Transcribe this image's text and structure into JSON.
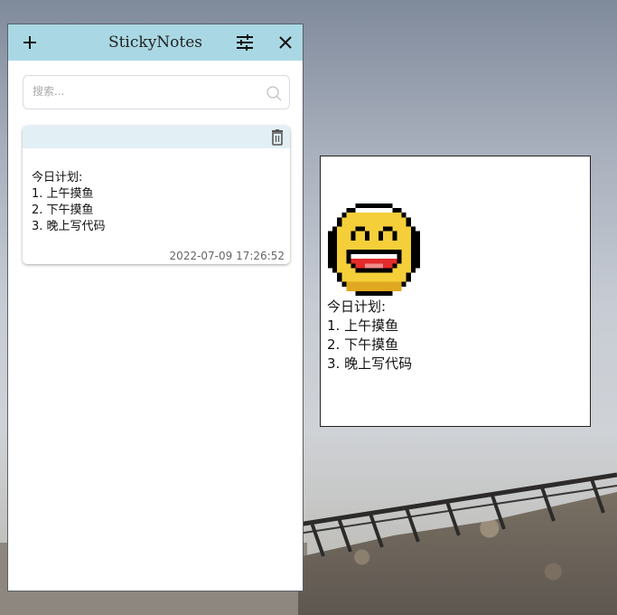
{
  "app": {
    "title": "StickyNotes",
    "add_icon": "plus-icon",
    "settings_icon": "sliders-icon",
    "close_icon": "close-icon",
    "titlebar_color": "#a9d8e4"
  },
  "search": {
    "placeholder": "搜索...",
    "value": "",
    "icon": "search-icon"
  },
  "notes": [
    {
      "lines": [
        "今日计划:",
        "1. 上午摸鱼",
        "2. 下午摸鱼",
        "3. 晚上写代码"
      ],
      "timestamp": "2022-07-09 17:26:52",
      "delete_icon": "trash-icon"
    }
  ],
  "open_note": {
    "image": "pixel-smiley-face",
    "lines": [
      "今日计划:",
      "1. 上午摸鱼",
      "2. 下午摸鱼",
      "3. 晚上写代码"
    ]
  }
}
